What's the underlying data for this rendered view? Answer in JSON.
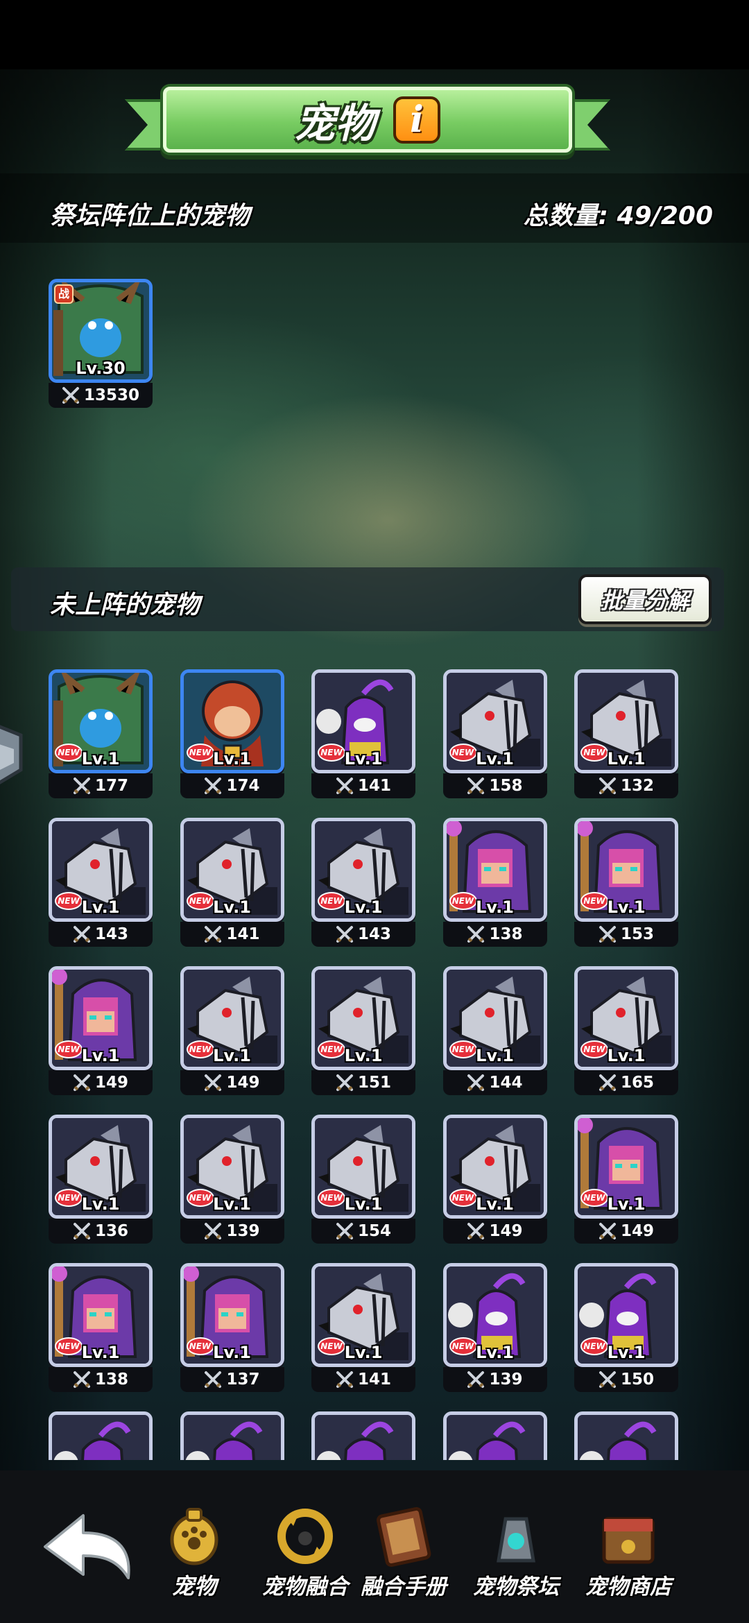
{
  "header": {
    "title": "宠物",
    "info_icon": "info-icon",
    "info_glyph": "i"
  },
  "altar": {
    "label": "祭坛阵位上的宠物",
    "total_label": "总数量: 49/200",
    "pets": [
      {
        "type": "tree-ent",
        "level": "Lv.30",
        "power": "13530",
        "rarity": "blue",
        "badge": "战"
      }
    ]
  },
  "unassigned": {
    "label": "未上阵的宠物",
    "batch_button": "批量分解",
    "pets": [
      {
        "type": "tree-ent",
        "level": "Lv.1",
        "power": "177",
        "rarity": "blue",
        "is_new": true
      },
      {
        "type": "dwarf",
        "level": "Lv.1",
        "power": "174",
        "rarity": "blue",
        "is_new": true
      },
      {
        "type": "imp",
        "level": "Lv.1",
        "power": "141",
        "rarity": "grey",
        "is_new": true
      },
      {
        "type": "wolf",
        "level": "Lv.1",
        "power": "158",
        "rarity": "grey",
        "is_new": true
      },
      {
        "type": "wolf",
        "level": "Lv.1",
        "power": "132",
        "rarity": "grey",
        "is_new": true
      },
      {
        "type": "wolf",
        "level": "Lv.1",
        "power": "143",
        "rarity": "grey",
        "is_new": true
      },
      {
        "type": "wolf",
        "level": "Lv.1",
        "power": "141",
        "rarity": "grey",
        "is_new": true
      },
      {
        "type": "wolf",
        "level": "Lv.1",
        "power": "143",
        "rarity": "grey",
        "is_new": true
      },
      {
        "type": "mage",
        "level": "Lv.1",
        "power": "138",
        "rarity": "grey",
        "is_new": true
      },
      {
        "type": "mage",
        "level": "Lv.1",
        "power": "153",
        "rarity": "grey",
        "is_new": true
      },
      {
        "type": "mage",
        "level": "Lv.1",
        "power": "149",
        "rarity": "grey",
        "is_new": true
      },
      {
        "type": "wolf",
        "level": "Lv.1",
        "power": "149",
        "rarity": "grey",
        "is_new": true
      },
      {
        "type": "wolf",
        "level": "Lv.1",
        "power": "151",
        "rarity": "grey",
        "is_new": true
      },
      {
        "type": "wolf",
        "level": "Lv.1",
        "power": "144",
        "rarity": "grey",
        "is_new": true
      },
      {
        "type": "wolf",
        "level": "Lv.1",
        "power": "165",
        "rarity": "grey",
        "is_new": true
      },
      {
        "type": "wolf",
        "level": "Lv.1",
        "power": "136",
        "rarity": "grey",
        "is_new": true
      },
      {
        "type": "wolf",
        "level": "Lv.1",
        "power": "139",
        "rarity": "grey",
        "is_new": true
      },
      {
        "type": "wolf",
        "level": "Lv.1",
        "power": "154",
        "rarity": "grey",
        "is_new": true
      },
      {
        "type": "wolf",
        "level": "Lv.1",
        "power": "149",
        "rarity": "grey",
        "is_new": true
      },
      {
        "type": "mage",
        "level": "Lv.1",
        "power": "149",
        "rarity": "grey",
        "is_new": true
      },
      {
        "type": "mage",
        "level": "Lv.1",
        "power": "138",
        "rarity": "grey",
        "is_new": true
      },
      {
        "type": "mage",
        "level": "Lv.1",
        "power": "137",
        "rarity": "grey",
        "is_new": true
      },
      {
        "type": "wolf",
        "level": "Lv.1",
        "power": "141",
        "rarity": "grey",
        "is_new": true
      },
      {
        "type": "imp",
        "level": "Lv.1",
        "power": "139",
        "rarity": "grey",
        "is_new": true
      },
      {
        "type": "imp",
        "level": "Lv.1",
        "power": "150",
        "rarity": "grey",
        "is_new": true
      },
      {
        "type": "imp",
        "level": "",
        "power": "",
        "rarity": "grey",
        "is_new": false
      },
      {
        "type": "imp",
        "level": "",
        "power": "",
        "rarity": "grey",
        "is_new": false
      },
      {
        "type": "imp",
        "level": "",
        "power": "",
        "rarity": "grey",
        "is_new": false
      },
      {
        "type": "imp",
        "level": "",
        "power": "",
        "rarity": "grey",
        "is_new": false
      },
      {
        "type": "imp",
        "level": "",
        "power": "",
        "rarity": "grey",
        "is_new": false
      }
    ]
  },
  "badges": {
    "new_text": "NEW"
  },
  "bottom_nav": {
    "back_icon": "back-arrow-icon",
    "items": [
      {
        "label": "宠物",
        "icon": "paw-bell-icon",
        "active": true
      },
      {
        "label": "宠物融合",
        "icon": "fusion-icon",
        "active": false
      },
      {
        "label": "融合手册",
        "icon": "handbook-icon",
        "active": false
      },
      {
        "label": "宠物祭坛",
        "icon": "altar-icon",
        "active": false
      },
      {
        "label": "宠物商店",
        "icon": "shop-icon",
        "active": false
      }
    ]
  },
  "colors": {
    "banner_green": "#78cc62",
    "info_orange": "#ff9f1c",
    "rare_blue": "#3d86f2",
    "common_grey": "#c6cde6",
    "new_red": "#e52f3a"
  }
}
